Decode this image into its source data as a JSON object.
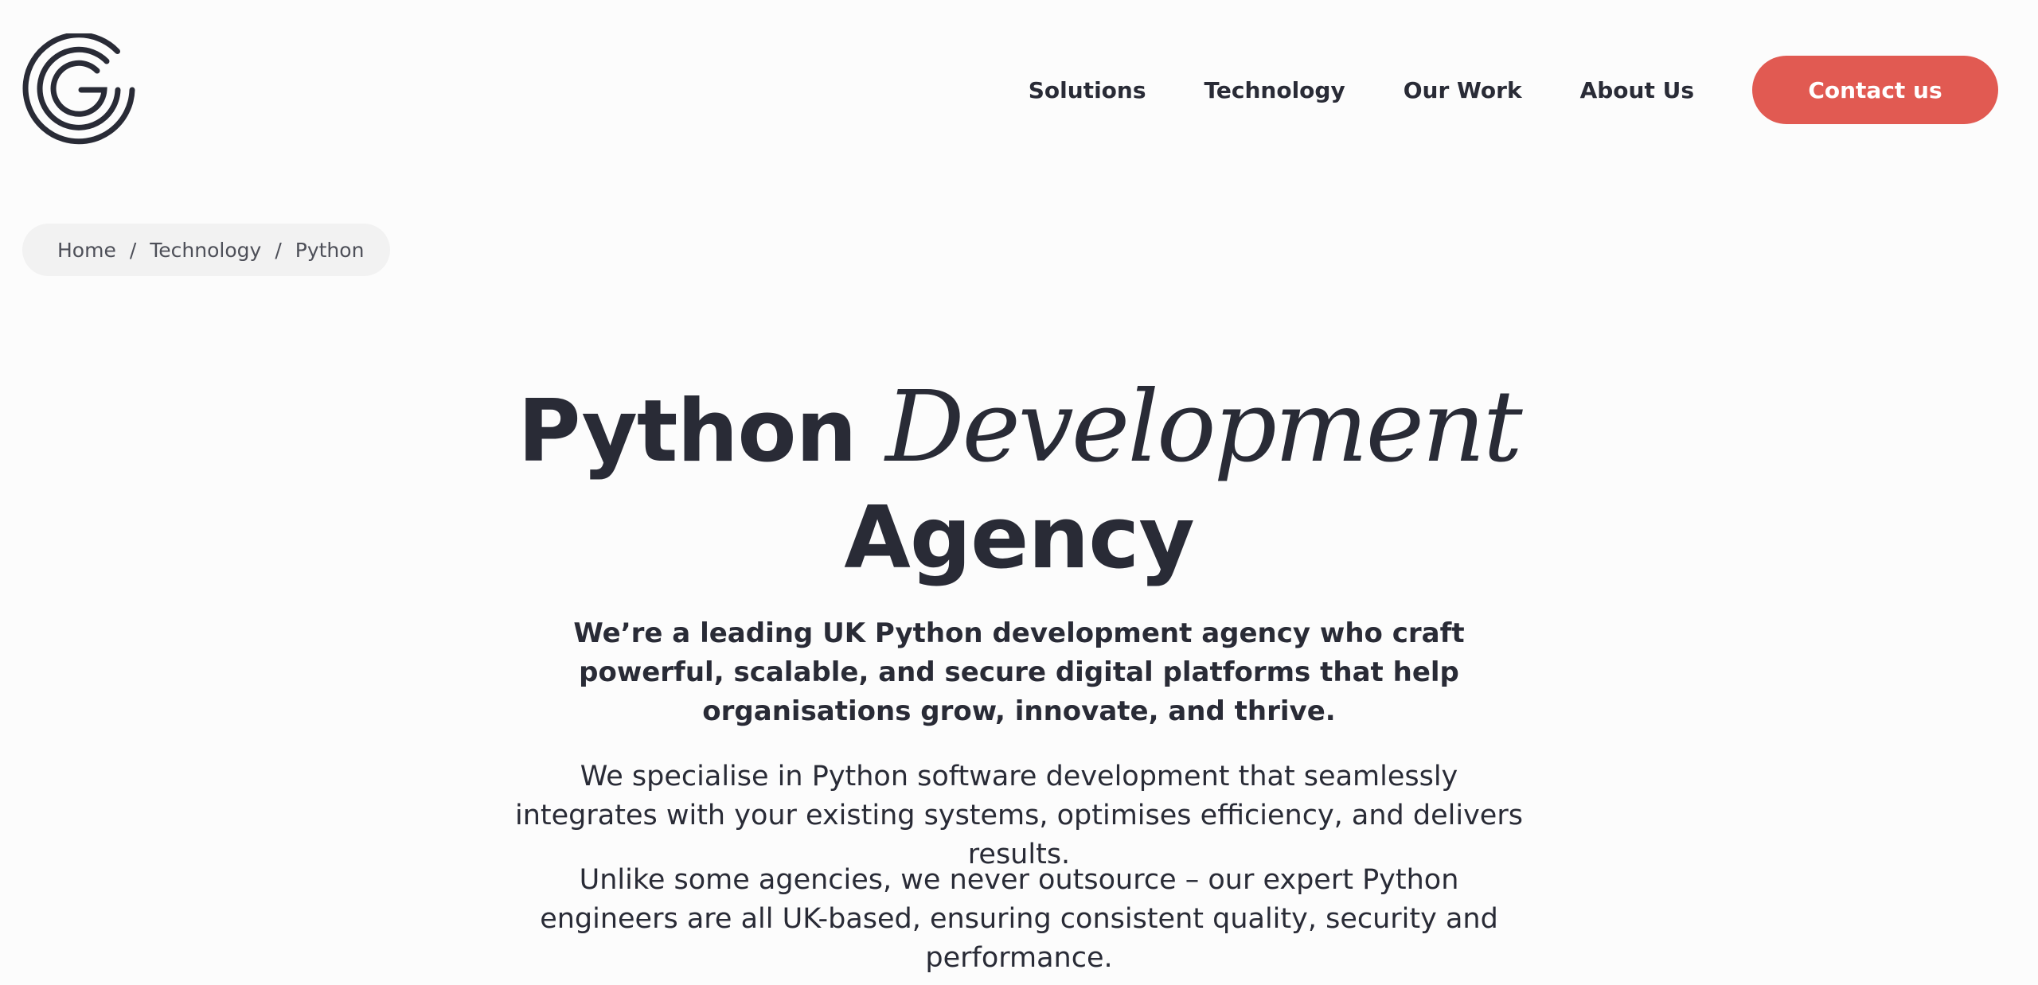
{
  "header": {
    "logo_name": "agency-logo",
    "nav": [
      {
        "label": "Solutions"
      },
      {
        "label": "Technology"
      },
      {
        "label": "Our Work"
      },
      {
        "label": "About Us"
      }
    ],
    "contact_label": "Contact us",
    "accent_color": "#e15a52"
  },
  "breadcrumb": {
    "items": [
      "Home",
      "Technology",
      "Python"
    ],
    "separator": "/"
  },
  "hero": {
    "title_part1": "Python",
    "title_script": "Development",
    "title_part2": "Agency",
    "lead": "We’re a leading UK Python development agency who craft powerful, scalable, and secure digital platforms that help organisations grow, innovate, and thrive.",
    "paragraph1": "We specialise in Python software development that seamlessly integrates with your existing systems, optimises efficiency, and delivers results.",
    "paragraph2": "Unlike some agencies, we never outsource – our expert Python engineers are all UK-based, ensuring consistent quality, security and performance."
  }
}
